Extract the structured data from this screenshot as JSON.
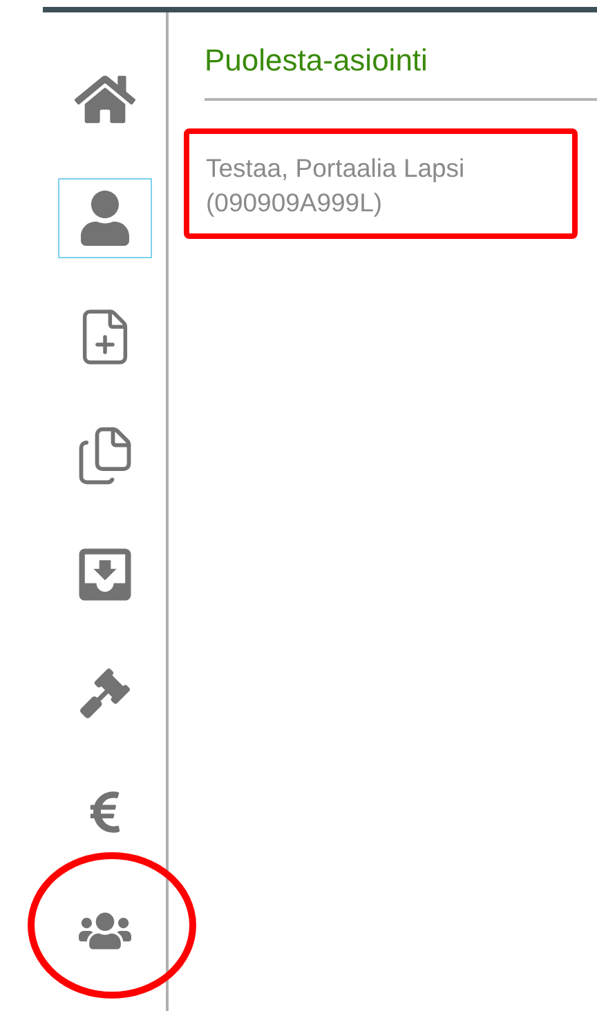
{
  "sidebar": {
    "items": [
      {
        "kind": "home",
        "selected": false,
        "circled": false
      },
      {
        "kind": "person",
        "selected": true,
        "circled": false
      },
      {
        "kind": "new-document",
        "selected": false,
        "circled": false
      },
      {
        "kind": "documents",
        "selected": false,
        "circled": false
      },
      {
        "kind": "inbox",
        "selected": false,
        "circled": false
      },
      {
        "kind": "gavel",
        "selected": false,
        "circled": false
      },
      {
        "kind": "euro",
        "selected": false,
        "circled": false
      },
      {
        "kind": "group",
        "selected": false,
        "circled": true
      }
    ]
  },
  "content": {
    "title": "Puolesta-asiointi",
    "card": {
      "highlighted": true,
      "name": "Testaa, Portaalia Lapsi",
      "id": "(090909A999L)"
    }
  }
}
